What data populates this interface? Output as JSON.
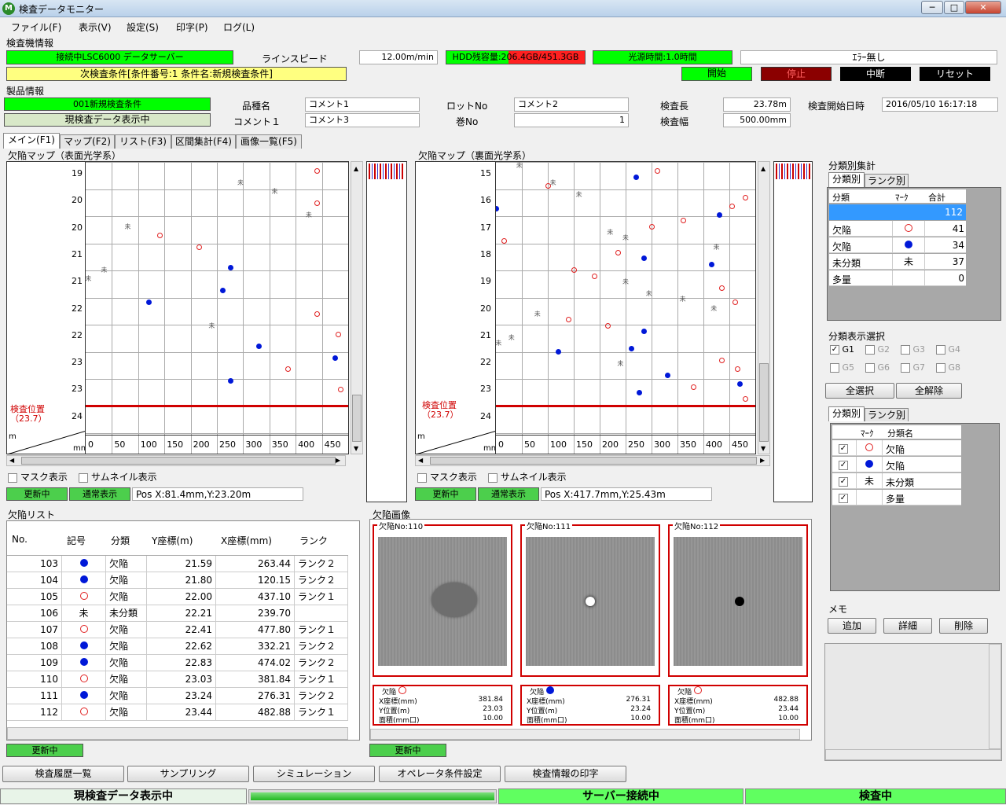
{
  "window": {
    "title": "検査データモニター",
    "minimize": "─",
    "maximize": "□",
    "close": "✕"
  },
  "menu": [
    "ファイル(F)",
    "表示(V)",
    "設定(S)",
    "印字(P)",
    "ログ(L)"
  ],
  "inspection": {
    "section": "検査機情報",
    "connection": "接続中LSC6000 データサーバー",
    "line_speed_label": "ラインスピード",
    "line_speed": "12.00m/min",
    "hdd_label": "HDD残容量:",
    "hdd_value": "206.4GB/451.3GB",
    "light_label": "光源時間:1.0時間",
    "error_status": "ｴﾗｰ無し",
    "next_condition": "次検査条件[条件番号:1 条件名:新規検査条件]",
    "buttons": {
      "start": "開始",
      "stop": "停止",
      "pause": "中断",
      "reset": "リセット"
    }
  },
  "product": {
    "section": "製品情報",
    "condition": "001新規検査条件",
    "display_mode": "現検査データ表示中",
    "hinmei_label": "品種名",
    "hinmei": "コメント1",
    "comment1_label": "コメント１",
    "comment1": "コメント3",
    "lot_label": "ロットNo",
    "lot": "コメント2",
    "roll_label": "巻No",
    "roll": "1",
    "length_label": "検査長",
    "length": "23.78m",
    "width_label": "検査幅",
    "width": "500.00mm",
    "start_label": "検査開始日時",
    "start": "2016/05/10 16:17:18"
  },
  "tabs": [
    "メイン(F1)",
    "マップ(F2)",
    "リスト(F3)",
    "区間集計(F4)",
    "画像一覧(F5)"
  ],
  "map_left": {
    "title": "欠陥マップ（表面光学系）",
    "y_labels": [
      "19",
      "20",
      "20",
      "21",
      "21",
      "22",
      "22",
      "23",
      "23",
      "24"
    ],
    "x_labels": [
      "0",
      "50",
      "100",
      "150",
      "200",
      "250",
      "300",
      "350",
      "400",
      "450"
    ],
    "unit_m": "m",
    "unit_mm": "mm",
    "position_label": "検査位置",
    "position_value": "（23.7）",
    "mask": "マスク表示",
    "thumbnail": "サムネイル表示",
    "updating": "更新中",
    "normal": "通常表示",
    "pos": "Pos X:81.4mm,Y:23.20m"
  },
  "map_right": {
    "title": "欠陥マップ（裏面光学系）",
    "y_labels": [
      "15",
      "16",
      "17",
      "18",
      "19",
      "20",
      "21",
      "22",
      "23",
      "24"
    ],
    "x_labels": [
      "0",
      "50",
      "100",
      "150",
      "200",
      "250",
      "300",
      "350",
      "400",
      "450"
    ],
    "unit_m": "m",
    "unit_mm": "mm",
    "position_label": "検査位置",
    "position_value": "（23.7）",
    "mask": "マスク表示",
    "thumbnail": "サムネイル表示",
    "updating": "更新中",
    "normal": "通常表示",
    "pos": "Pos X:417.7mm,Y:25.43m"
  },
  "summary": {
    "title": "分類別集計",
    "tabs": [
      "分類別",
      "ランク別"
    ],
    "headers": [
      "分類",
      "ﾏｰｸ",
      "合計"
    ],
    "total": "112",
    "rows": [
      {
        "name": "欠陥",
        "mark": "ring",
        "count": "41"
      },
      {
        "name": "欠陥",
        "mark": "dot",
        "count": "34"
      },
      {
        "name": "未分類",
        "mark": "未",
        "count": "37"
      },
      {
        "name": "多量",
        "mark": "",
        "count": "0"
      }
    ]
  },
  "class_select": {
    "title": "分類表示選択",
    "groups": [
      "G1",
      "G2",
      "G3",
      "G4",
      "G5",
      "G6",
      "G7",
      "G8"
    ],
    "select_all": "全選択",
    "clear_all": "全解除"
  },
  "class_list": {
    "tabs": [
      "分類別",
      "ランク別"
    ],
    "headers": [
      "ﾏｰｸ",
      "分類名"
    ],
    "rows": [
      {
        "mark": "ring",
        "name": "欠陥"
      },
      {
        "mark": "dot",
        "name": "欠陥"
      },
      {
        "mark": "未",
        "name": "未分類"
      },
      {
        "mark": "",
        "name": "多量"
      }
    ]
  },
  "memo": {
    "title": "メモ",
    "add": "追加",
    "detail": "詳細",
    "delete": "削除"
  },
  "defect_list": {
    "title": "欠陥リスト",
    "headers": [
      "No.",
      "記号",
      "分類",
      "Y座標(m)",
      "X座標(mm)",
      "ランク"
    ],
    "rows": [
      {
        "no": "103",
        "mark": "dot",
        "cls": "欠陥",
        "y": "21.59",
        "x": "263.44",
        "rank": "ランク２"
      },
      {
        "no": "104",
        "mark": "dot",
        "cls": "欠陥",
        "y": "21.80",
        "x": "120.15",
        "rank": "ランク２"
      },
      {
        "no": "105",
        "mark": "ring",
        "cls": "欠陥",
        "y": "22.00",
        "x": "437.10",
        "rank": "ランク１"
      },
      {
        "no": "106",
        "mark": "未",
        "cls": "未分類",
        "y": "22.21",
        "x": "239.70",
        "rank": ""
      },
      {
        "no": "107",
        "mark": "ring",
        "cls": "欠陥",
        "y": "22.41",
        "x": "477.80",
        "rank": "ランク１"
      },
      {
        "no": "108",
        "mark": "dot",
        "cls": "欠陥",
        "y": "22.62",
        "x": "332.21",
        "rank": "ランク２"
      },
      {
        "no": "109",
        "mark": "dot",
        "cls": "欠陥",
        "y": "22.83",
        "x": "474.02",
        "rank": "ランク２"
      },
      {
        "no": "110",
        "mark": "ring",
        "cls": "欠陥",
        "y": "23.03",
        "x": "381.84",
        "rank": "ランク１"
      },
      {
        "no": "111",
        "mark": "dot",
        "cls": "欠陥",
        "y": "23.24",
        "x": "276.31",
        "rank": "ランク２"
      },
      {
        "no": "112",
        "mark": "ring",
        "cls": "欠陥",
        "y": "23.44",
        "x": "482.88",
        "rank": "ランク１"
      }
    ],
    "updating": "更新中"
  },
  "defect_images": {
    "title": "欠陥画像",
    "items": [
      {
        "label": "欠陥No:110",
        "cls": "欠陥",
        "mark": "ring",
        "x_label": "X座標(mm)",
        "x": "381.84",
        "y_label": "Y位置(m)",
        "y": "23.03",
        "area_label": "面積(mm口)",
        "area": "10.00"
      },
      {
        "label": "欠陥No:111",
        "cls": "欠陥",
        "mark": "dot",
        "x_label": "X座標(mm)",
        "x": "276.31",
        "y_label": "Y位置(m)",
        "y": "23.24",
        "area_label": "面積(mm口)",
        "area": "10.00"
      },
      {
        "label": "欠陥No:112",
        "cls": "欠陥",
        "mark": "ring",
        "x_label": "X座標(mm)",
        "x": "482.88",
        "y_label": "Y位置(m)",
        "y": "23.44",
        "area_label": "面積(mm口)",
        "area": "10.00"
      }
    ],
    "updating": "更新中"
  },
  "bottom_buttons": [
    "検査履歴一覧",
    "サンプリング",
    "シミュレーション",
    "オペレータ条件設定",
    "検査情報の印字"
  ],
  "status": {
    "left": "現検査データ表示中",
    "server": "サーバー接続中",
    "inspecting": "検査中"
  },
  "colors": {
    "green": "#00ff00",
    "yellow": "#ffff80",
    "red": "#d00000",
    "dot_blue": "#0018d8",
    "ring_red": "#e02020"
  }
}
